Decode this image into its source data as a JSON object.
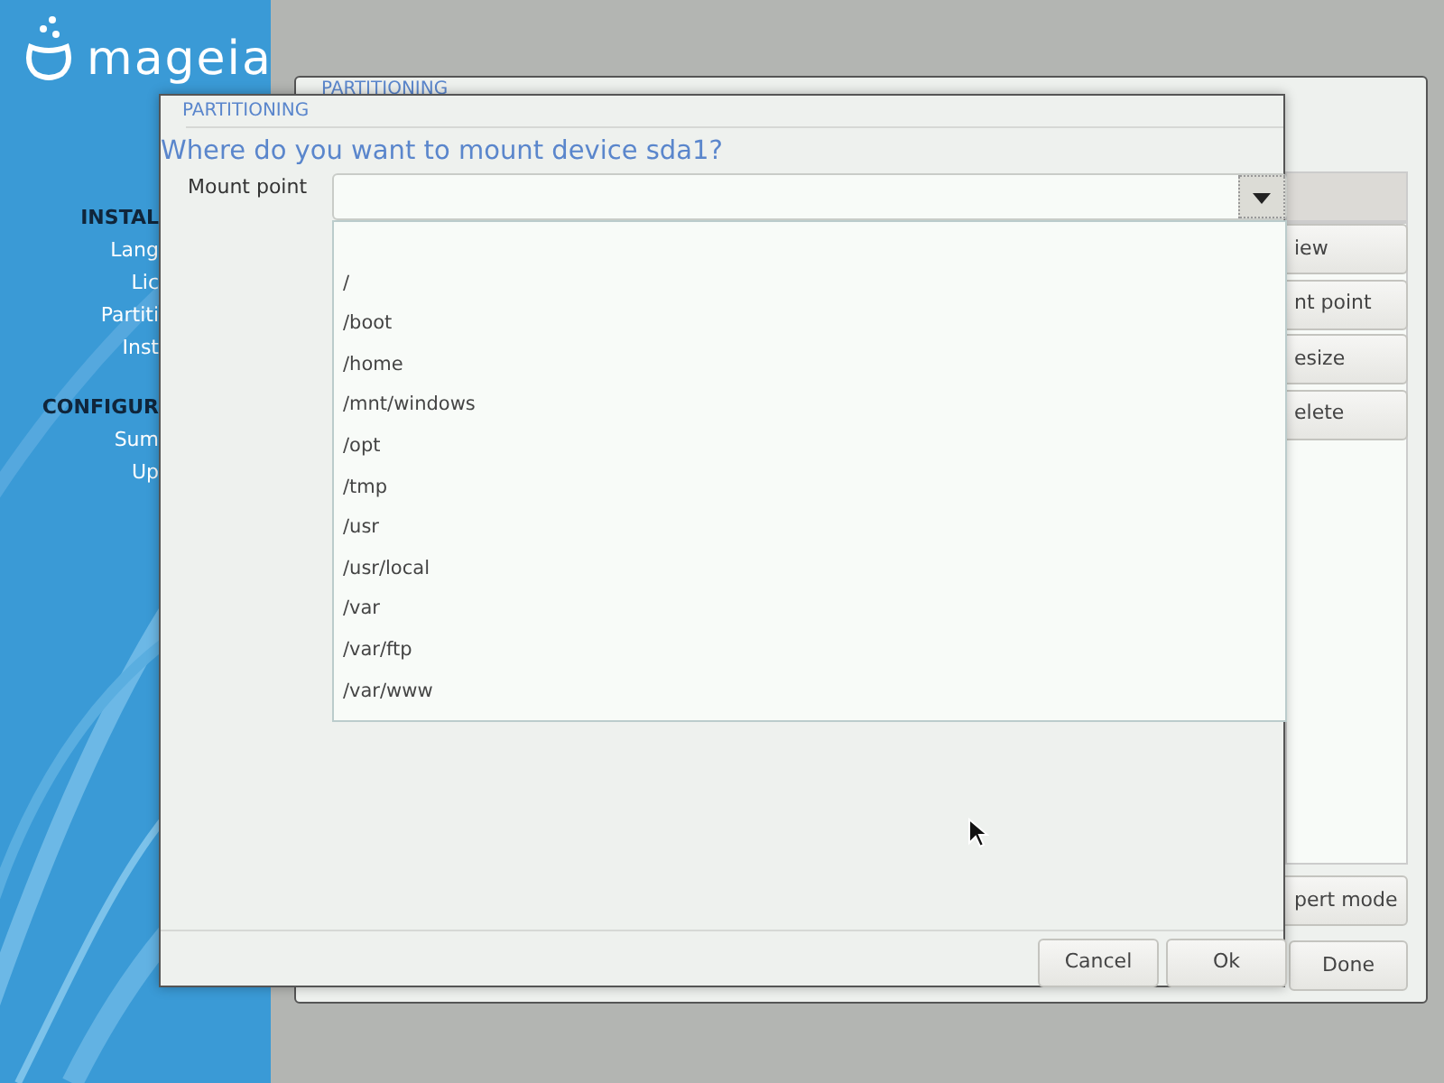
{
  "sidebar": {
    "logo": "mageia",
    "sections": [
      {
        "title": "INSTAL",
        "items": [
          "Lang",
          "Lic",
          "Partiti",
          "Inst"
        ]
      },
      {
        "title": "CONFIGUR",
        "items": [
          "Sum",
          "Up"
        ]
      }
    ]
  },
  "back_window": {
    "title": "PARTITIONING",
    "buttons": [
      "iew",
      "nt point",
      "esize",
      "elete"
    ],
    "expert_button": "pert mode",
    "done_button": "Done"
  },
  "dialog": {
    "title": "PARTITIONING",
    "question": "Where do you want to mount device sda1?",
    "label": "Mount point",
    "options": [
      "/",
      "/boot",
      "/home",
      "/mnt/windows",
      "/opt",
      "/tmp",
      "/usr",
      "/usr/local",
      "/var",
      "/var/ftp",
      "/var/www"
    ],
    "buttons": [
      "Cancel",
      "Ok"
    ]
  }
}
